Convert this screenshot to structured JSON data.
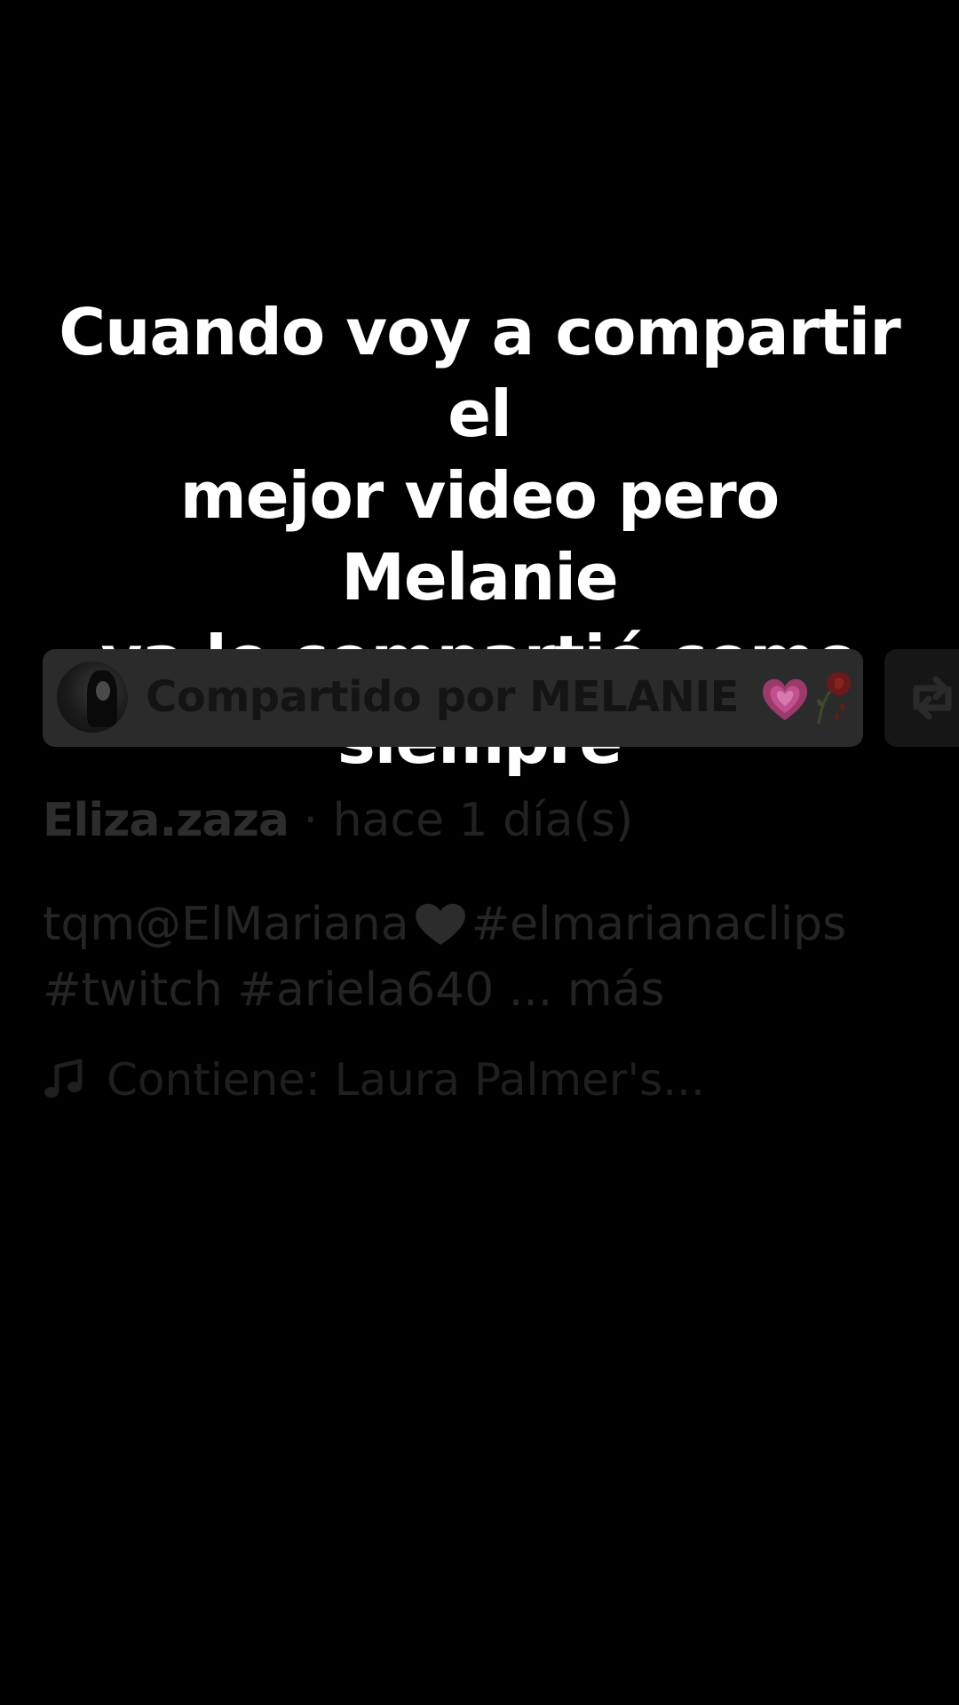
{
  "caption": {
    "line1": "Cuando voy a compartir el",
    "line2": "mejor video pero Melanie",
    "line3": "ya lo compartió como",
    "line4": "siempre"
  },
  "share_banner": {
    "label": "Compartido por MELANIE",
    "emojis": [
      "pink-heart-icon",
      "wilted-rose-icon"
    ]
  },
  "repost": {
    "icon": "repost-icon"
  },
  "post": {
    "author": "Eliza.zaza",
    "separator": "·",
    "time_ago": "hace 1 día(s)",
    "description_part1": "tqm@ElMariana",
    "description_part2": "#elmarianaclips",
    "description_part3": "#twitch #ariela640",
    "ellipsis": "...",
    "more_label": "más",
    "music_icon": "music-note-icon",
    "music_text": "Contiene: Laura Palmer's..."
  },
  "colors": {
    "background": "#000000",
    "caption_text": "#ffffff",
    "banner_bg": "#2b2b2b",
    "dim_text": "#242424",
    "heart_pink": "#b3407a"
  }
}
